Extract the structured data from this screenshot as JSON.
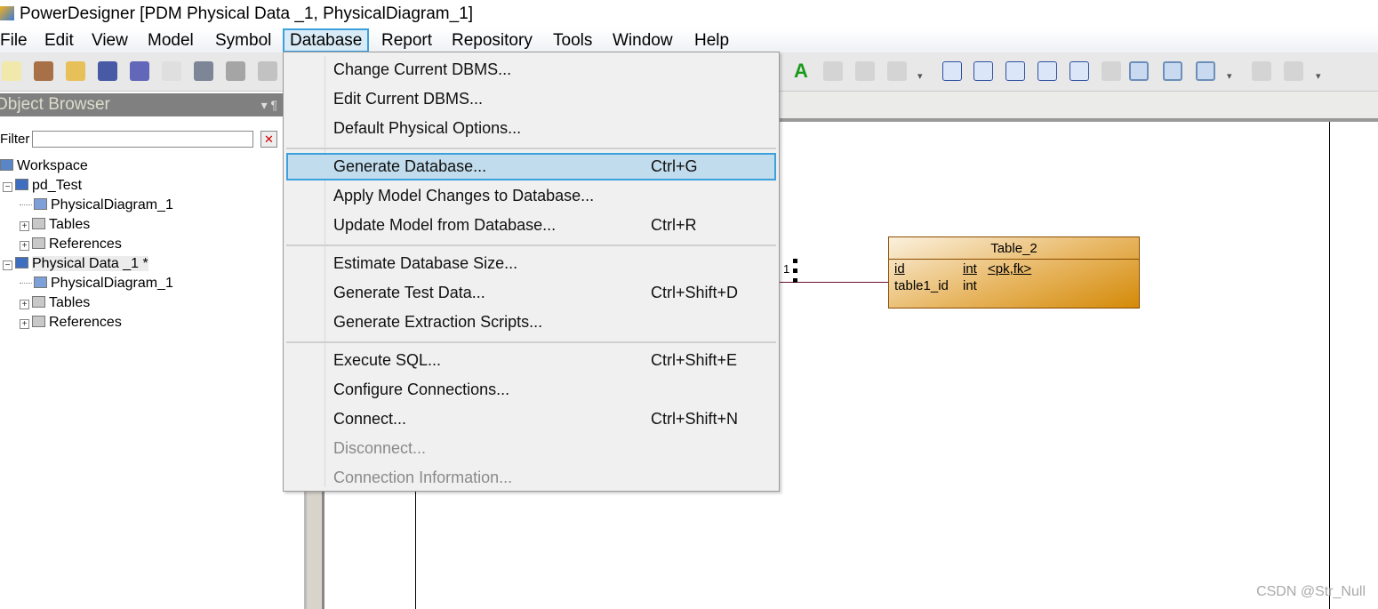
{
  "window": {
    "title": "PowerDesigner [PDM Physical Data _1, PhysicalDiagram_1]"
  },
  "menubar": [
    "File",
    "Edit",
    "View",
    "Model",
    "Symbol",
    "Database",
    "Report",
    "Repository",
    "Tools",
    "Window",
    "Help"
  ],
  "active_menu": "Database",
  "toolbar": {
    "left_icons": [
      "new-icon",
      "new-project-icon",
      "open-icon",
      "save-icon",
      "save-all-icon",
      "print-preview-icon",
      "print-icon",
      "cut-icon",
      "copy-icon"
    ],
    "right_icons": [
      "font-icon",
      "import-icon",
      "undo-icon",
      "redo-icon",
      "diagram-icon",
      "table-diagram-icon",
      "page-icon",
      "pages-icon",
      "generate-icon",
      "model-icon",
      "zoom-icon",
      "comment-icon",
      "grid-icon",
      "print-preview-icon",
      "print-icon"
    ]
  },
  "object_browser": {
    "title": "Object Browser",
    "filter_label": "Filter",
    "filter_value": "",
    "tree": [
      {
        "label": "Workspace",
        "level": 0,
        "icon": "workspace-icon"
      },
      {
        "label": "pd_Test",
        "level": 1,
        "icon": "model-icon",
        "expander": "−"
      },
      {
        "label": "PhysicalDiagram_1",
        "level": 2,
        "icon": "diagram-icon"
      },
      {
        "label": "Tables",
        "level": 2,
        "icon": "folder-icon",
        "expander": "+"
      },
      {
        "label": "References",
        "level": 2,
        "icon": "folder-icon",
        "expander": "+"
      },
      {
        "label": "Physical Data _1 *",
        "level": 1,
        "icon": "model-icon",
        "expander": "−",
        "selected": true
      },
      {
        "label": "PhysicalDiagram_1",
        "level": 2,
        "icon": "diagram-icon"
      },
      {
        "label": "Tables",
        "level": 2,
        "icon": "folder-icon",
        "expander": "+"
      },
      {
        "label": "References",
        "level": 2,
        "icon": "folder-icon",
        "expander": "+"
      }
    ]
  },
  "database_menu": [
    {
      "label": "Change Current DBMS...",
      "shortcut": ""
    },
    {
      "label": "Edit Current DBMS...",
      "shortcut": ""
    },
    {
      "label": "Default Physical Options...",
      "shortcut": ""
    },
    {
      "separator": true
    },
    {
      "label": "Generate Database...",
      "shortcut": "Ctrl+G",
      "highlighted": true
    },
    {
      "label": "Apply Model Changes to Database...",
      "shortcut": ""
    },
    {
      "label": "Update Model from Database...",
      "shortcut": "Ctrl+R"
    },
    {
      "separator": true
    },
    {
      "label": "Estimate Database Size...",
      "shortcut": ""
    },
    {
      "label": "Generate Test Data...",
      "shortcut": "Ctrl+Shift+D"
    },
    {
      "label": "Generate Extraction Scripts...",
      "shortcut": ""
    },
    {
      "separator": true
    },
    {
      "label": "Execute SQL...",
      "shortcut": "Ctrl+Shift+E"
    },
    {
      "label": "Configure Connections...",
      "shortcut": ""
    },
    {
      "label": "Connect...",
      "shortcut": "Ctrl+Shift+N"
    },
    {
      "label": "Disconnect...",
      "shortcut": "",
      "disabled": true
    },
    {
      "label": "Connection Information...",
      "shortcut": "",
      "disabled": true
    }
  ],
  "diagram": {
    "table": {
      "name": "Table_2",
      "columns": [
        {
          "name": "id",
          "type": "int",
          "keys": "<pk,fk>"
        },
        {
          "name": "table1_id",
          "type": "int",
          "keys": ""
        }
      ]
    },
    "reference_cardinality": "1"
  },
  "watermark": "CSDN @Str_Null",
  "colors": {
    "menu_highlight": "#c1dcec",
    "menu_highlight_border": "#3ca0dc",
    "table_fill": "#e7b560"
  }
}
